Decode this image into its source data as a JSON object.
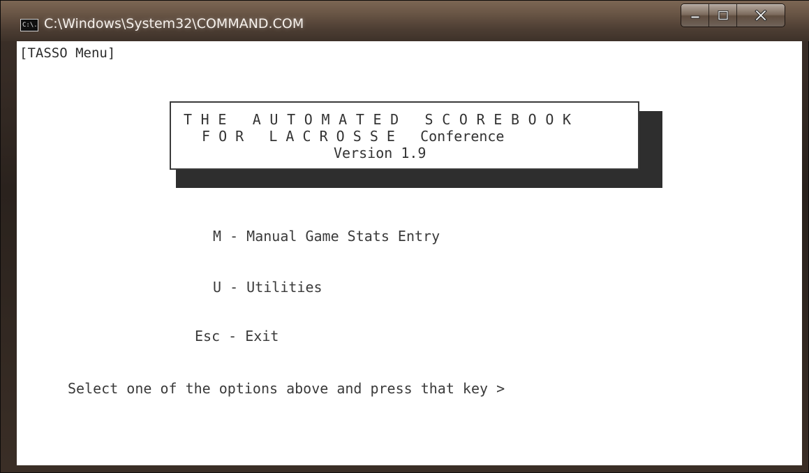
{
  "window": {
    "title": "C:\\Windows\\System32\\COMMAND.COM",
    "icon_text": "C:\\.",
    "controls": [
      "minimize-icon",
      "maximize-icon",
      "close-icon"
    ]
  },
  "console": {
    "menu_label": "[TASSO Menu]",
    "banner": {
      "line1": "T H E   A U T O M A T E D   S C O R E B O O K",
      "line2": "F O R   L A C R O S S E   Conference",
      "line3": "Version 1.9"
    },
    "options": [
      {
        "label": "M - Manual Game Stats Entry"
      },
      {
        "label": "U - Utilities"
      },
      {
        "label": "Esc - Exit"
      }
    ],
    "prompt": "Select one of the options above and press that key >"
  },
  "colors": {
    "console_bg": "#ffffff",
    "console_text": "#3a3a3a",
    "titlebar": "#5a4a3e"
  }
}
